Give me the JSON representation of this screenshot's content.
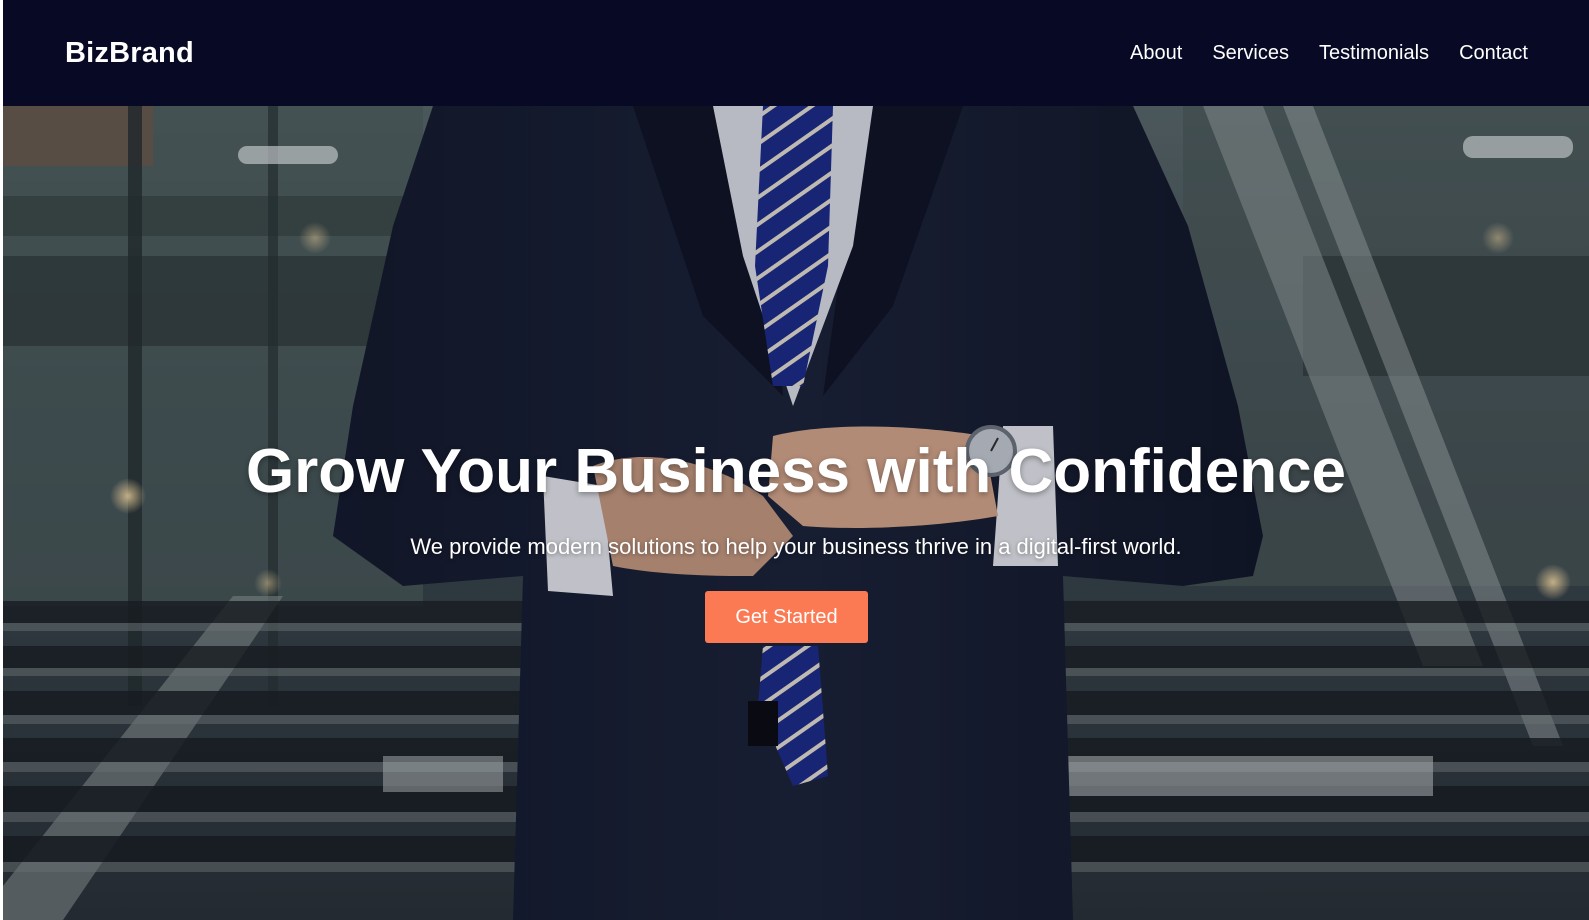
{
  "header": {
    "logo": "BizBrand",
    "nav": [
      {
        "label": "About"
      },
      {
        "label": "Services"
      },
      {
        "label": "Testimonials"
      },
      {
        "label": "Contact"
      }
    ]
  },
  "hero": {
    "title": "Grow Your Business with Confidence",
    "subtitle": "We provide modern solutions to help your business thrive in a digital-first world.",
    "cta_label": "Get Started"
  },
  "colors": {
    "header_bg": "#070925",
    "cta_bg": "#fb7a53",
    "text": "#ffffff"
  }
}
